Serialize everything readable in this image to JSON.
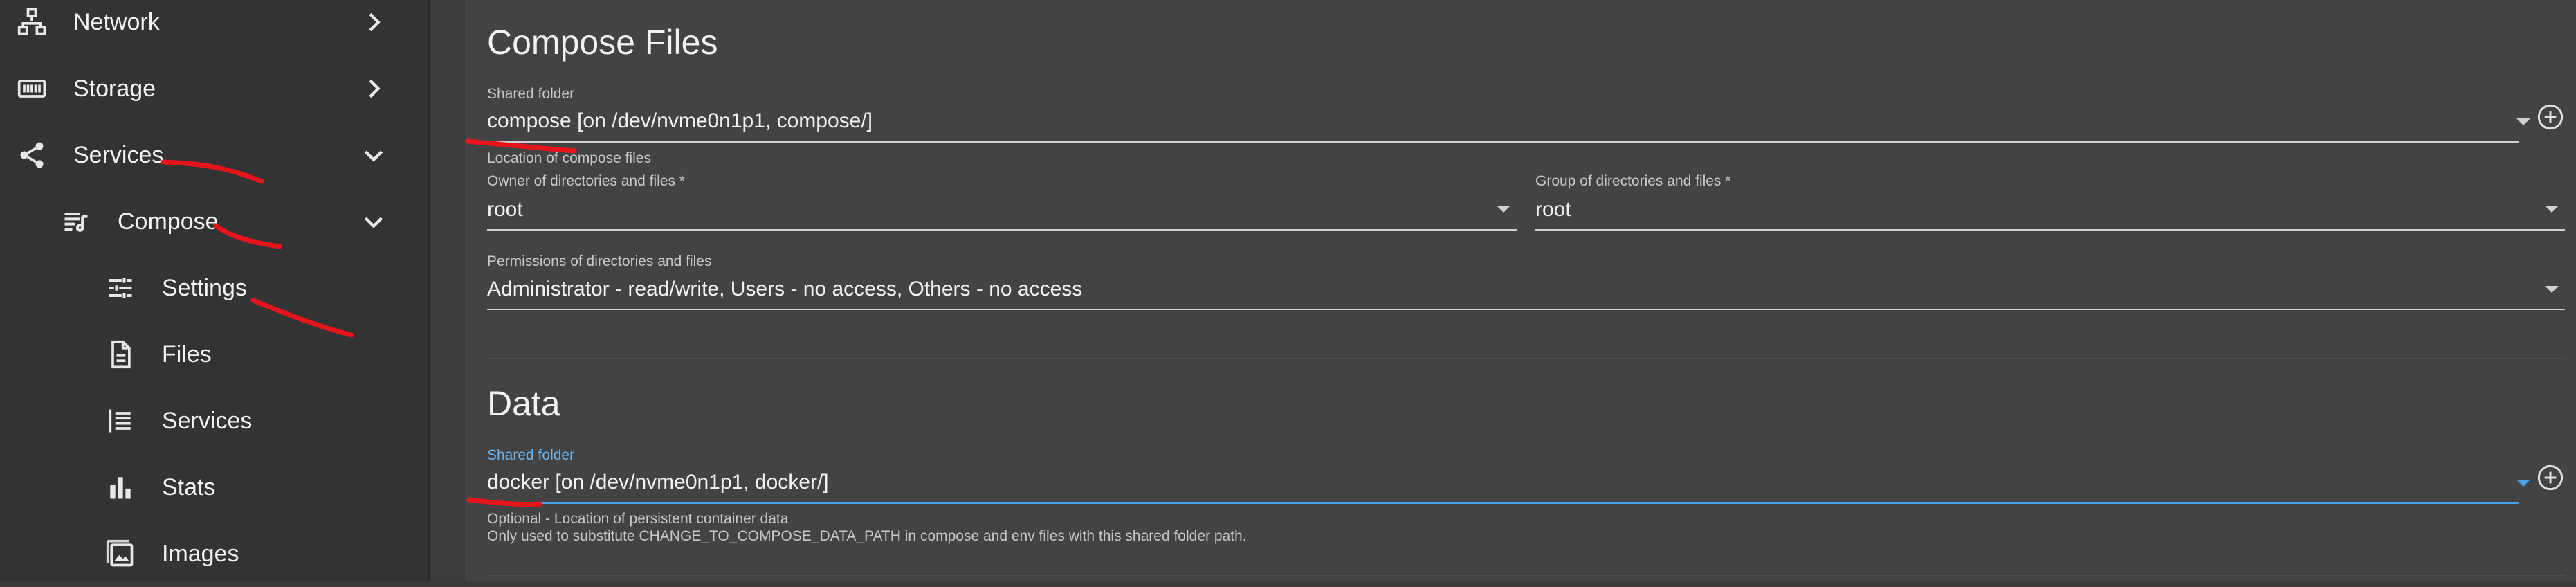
{
  "sidebar": {
    "items": [
      {
        "label": "Network",
        "icon": "network-icon",
        "chevron": "chevron-right-icon"
      },
      {
        "label": "Storage",
        "icon": "storage-icon",
        "chevron": "chevron-right-icon"
      },
      {
        "label": "Services",
        "icon": "share-icon",
        "chevron": "chevron-down-icon"
      },
      {
        "label": "Compose",
        "icon": "compose-icon",
        "chevron": "chevron-down-icon"
      },
      {
        "label": "Settings",
        "icon": "tune-icon"
      },
      {
        "label": "Files",
        "icon": "file-icon"
      },
      {
        "label": "Services",
        "icon": "list-icon"
      },
      {
        "label": "Stats",
        "icon": "bar-chart-icon"
      },
      {
        "label": "Images",
        "icon": "image-icon"
      }
    ]
  },
  "compose_files": {
    "title": "Compose Files",
    "shared_folder_label": "Shared folder",
    "shared_folder_value": "compose [on /dev/nvme0n1p1, compose/]",
    "shared_folder_hint": "Location of compose files",
    "owner_label": "Owner of directories and files *",
    "owner_value": "root",
    "group_label": "Group of directories and files *",
    "group_value": "root",
    "permissions_label": "Permissions of directories and files",
    "permissions_value": "Administrator - read/write, Users - no access, Others - no access"
  },
  "data_section": {
    "title": "Data",
    "shared_folder_label": "Shared folder",
    "shared_folder_value": "docker [on /dev/nvme0n1p1, docker/]",
    "hint_line1": "Optional - Location of persistent container data",
    "hint_line2": "Only used to substitute CHANGE_TO_COMPOSE_DATA_PATH in compose and env files with this shared folder path."
  },
  "colors": {
    "sidebar_bg": "#333333",
    "main_bg": "#434343",
    "accent": "#4aa3e8",
    "annotation": "#e8141c"
  }
}
